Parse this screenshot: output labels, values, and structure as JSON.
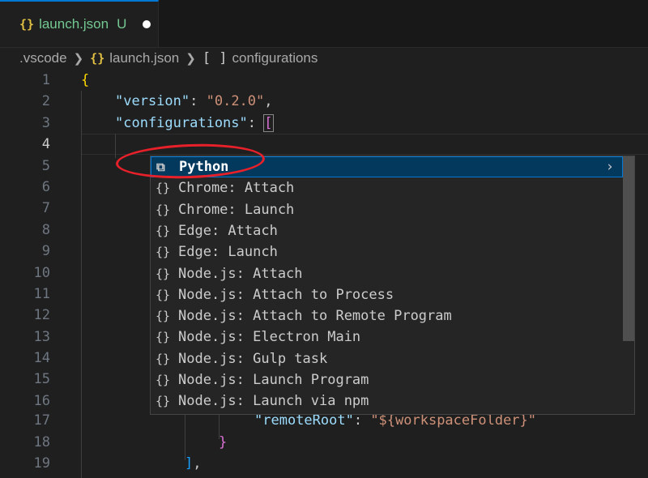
{
  "tab": {
    "icon": "json-braces-icon",
    "braces": "{}",
    "filename": "launch.json",
    "status": "U"
  },
  "breadcrumb": {
    "folder": ".vscode",
    "file_braces": "{}",
    "file": "launch.json",
    "array_icon": "[ ]",
    "symbol": "configurations"
  },
  "lines": [
    "1",
    "2",
    "3",
    "4",
    "5",
    "6",
    "7",
    "8",
    "9",
    "10",
    "11",
    "12",
    "13",
    "14",
    "15",
    "16",
    "17",
    "18",
    "19"
  ],
  "active_line": "4",
  "code": {
    "l1": "{",
    "l2_key": "\"version\"",
    "l2_colon": ": ",
    "l2_val": "\"0.2.0\"",
    "l2_comma": ",",
    "l3_key": "\"configurations\"",
    "l3_colon": ": ",
    "l3_bracket": "[",
    "l17_key": "\"remoteRoot\"",
    "l17_colon": ": ",
    "l17_val": "\"${workspaceFolder}\"",
    "l18": "}",
    "l19_bracket": "]",
    "l19_comma": ","
  },
  "suggestions": [
    {
      "icon": "⧉",
      "label": "Python",
      "more": "›"
    },
    {
      "icon": "{}",
      "label": "Chrome: Attach"
    },
    {
      "icon": "{}",
      "label": "Chrome: Launch"
    },
    {
      "icon": "{}",
      "label": "Edge: Attach"
    },
    {
      "icon": "{}",
      "label": "Edge: Launch"
    },
    {
      "icon": "{}",
      "label": "Node.js: Attach"
    },
    {
      "icon": "{}",
      "label": "Node.js: Attach to Process"
    },
    {
      "icon": "{}",
      "label": "Node.js: Attach to Remote Program"
    },
    {
      "icon": "{}",
      "label": "Node.js: Electron Main"
    },
    {
      "icon": "{}",
      "label": "Node.js: Gulp task"
    },
    {
      "icon": "{}",
      "label": "Node.js: Launch Program"
    },
    {
      "icon": "{}",
      "label": "Node.js: Launch via npm"
    }
  ],
  "colors": {
    "accent": "#0078d4",
    "annotation": "#e8202a",
    "selected_bg": "#04395e"
  }
}
